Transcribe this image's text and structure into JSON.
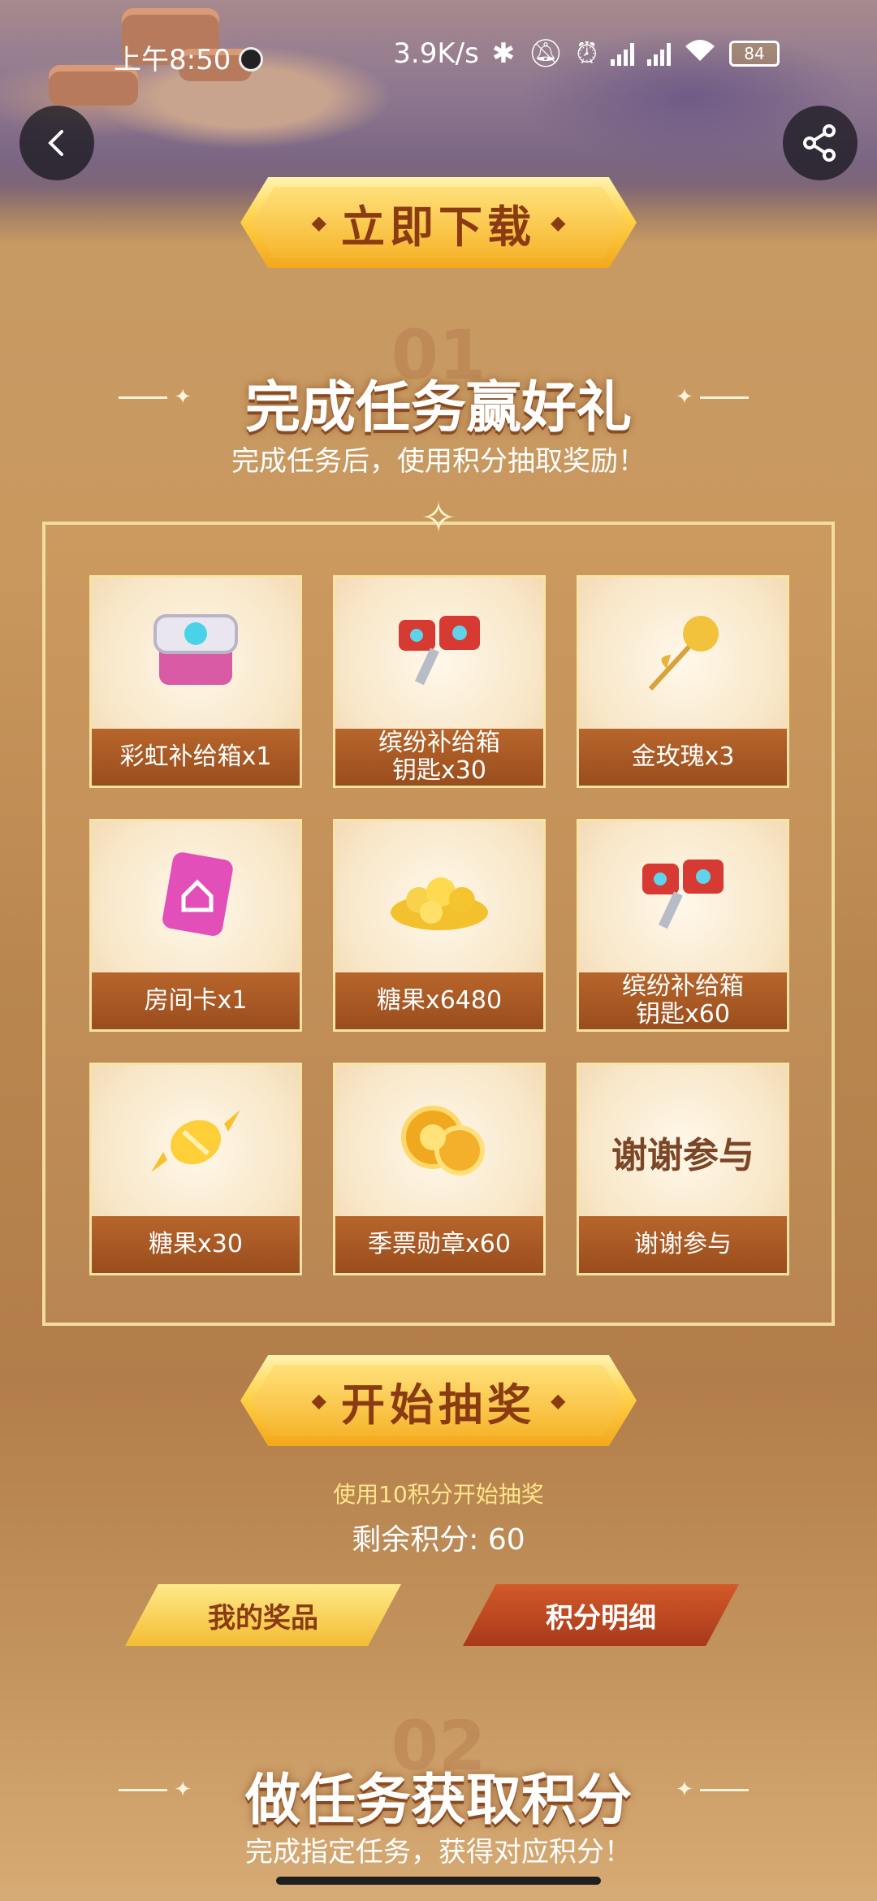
{
  "status_bar": {
    "time": "上午8:50",
    "net_speed": "3.9K/s",
    "battery": "84"
  },
  "header": {
    "download_button": "立即下载"
  },
  "section1": {
    "number": "01",
    "title": "完成任务赢好礼",
    "subtitle": "完成任务后，使用积分抽取奖励！"
  },
  "prizes": [
    {
      "label": "彩虹补给箱x1",
      "icon": "supply-box-icon"
    },
    {
      "label": "缤纷补给箱\n钥匙x30",
      "icon": "key-icon"
    },
    {
      "label": "金玫瑰x3",
      "icon": "gold-rose-icon"
    },
    {
      "label": "房间卡x1",
      "icon": "room-card-icon"
    },
    {
      "label": "糖果x6480",
      "icon": "candy-pile-icon"
    },
    {
      "label": "缤纷补给箱\n钥匙x60",
      "icon": "key-icon"
    },
    {
      "label": "糖果x30",
      "icon": "candy-icon"
    },
    {
      "label": "季票勋章x60",
      "icon": "medal-icon"
    },
    {
      "label": "谢谢参与",
      "icon": "",
      "thanks_text": "谢谢参与"
    }
  ],
  "draw": {
    "button": "开始抽奖",
    "hint": "使用10积分开始抽奖",
    "remaining_label": "剩余积分: 60"
  },
  "tabs": {
    "my_prizes": "我的奖品",
    "points_detail": "积分明细"
  },
  "section2": {
    "number": "02",
    "title": "做任务获取积分",
    "subtitle": "完成指定任务，获得对应积分！"
  },
  "colors": {
    "gold": "#ffd24a",
    "brown": "#8a3b12",
    "label_bg": "#9a4d1d",
    "accent_red": "#a8391a"
  }
}
